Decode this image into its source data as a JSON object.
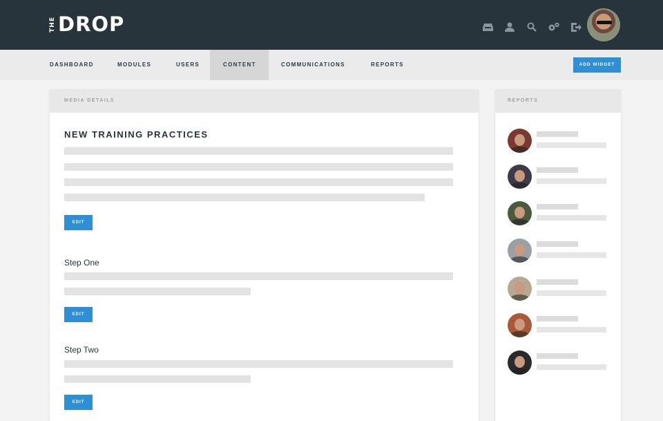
{
  "brand": {
    "the": "THE",
    "word": "DROP"
  },
  "header_icons": [
    "inbox-icon",
    "user-icon",
    "search-icon",
    "settings-icon",
    "logout-icon"
  ],
  "nav": {
    "items": [
      "DASHBOARD",
      "MODULES",
      "USERS",
      "CONTENT",
      "COMMUNICATIONS",
      "REPORTS"
    ],
    "active": "CONTENT",
    "add_widget": "ADD WIDGET"
  },
  "media_panel": {
    "header": "MEDIA DETAILS",
    "title": "NEW TRAINING PRACTICES",
    "edit_label": "EDIT",
    "steps": [
      {
        "title": "Step One",
        "edit_label": "EDIT"
      },
      {
        "title": "Step Two",
        "edit_label": "EDIT"
      }
    ]
  },
  "reports_panel": {
    "header": "REPORTS",
    "count": 7
  },
  "colors": {
    "header_bg": "#27343b",
    "nav_bg": "#ebebeb",
    "nav_active_bg": "#d6d6d6",
    "accent": "#2f8fd6",
    "placeholder": "#e3e3e3"
  }
}
